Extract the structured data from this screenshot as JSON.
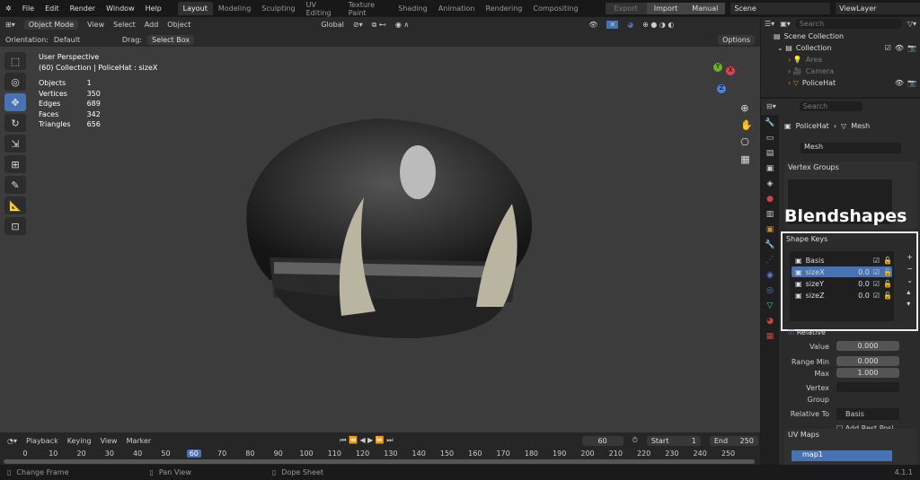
{
  "menu": [
    "File",
    "Edit",
    "Render",
    "Window",
    "Help"
  ],
  "workspaces": [
    "Layout",
    "Modeling",
    "Sculpting",
    "UV Editing",
    "Texture Paint",
    "Shading",
    "Animation",
    "Rendering",
    "Compositing"
  ],
  "top_right": {
    "export": "Export",
    "import": "Import",
    "manual": "Manual",
    "scene": "Scene",
    "view_layer": "ViewLayer"
  },
  "header": {
    "mode": "Object Mode",
    "items": [
      "View",
      "Select",
      "Add",
      "Object"
    ],
    "transform": "Global",
    "options": "Options"
  },
  "tool_settings": {
    "orientation_label": "Orientation:",
    "orientation": "Default",
    "drag_label": "Drag:",
    "drag": "Select Box"
  },
  "viewport": {
    "title": "User Perspective",
    "subtitle": "(60) Collection | PoliceHat : sizeX",
    "stats": [
      {
        "k": "Objects",
        "v": "1"
      },
      {
        "k": "Vertices",
        "v": "350"
      },
      {
        "k": "Edges",
        "v": "689"
      },
      {
        "k": "Faces",
        "v": "342"
      },
      {
        "k": "Triangles",
        "v": "656"
      }
    ],
    "gizmo": {
      "x": "X",
      "y": "Y",
      "z": "Z"
    }
  },
  "outliner": {
    "search": "Search",
    "scene_collection": "Scene Collection",
    "collection": "Collection",
    "items": [
      "Area",
      "Camera",
      "PoliceHat"
    ]
  },
  "properties": {
    "search": "Search",
    "breadcrumb_obj": "PoliceHat",
    "breadcrumb_data": "Mesh",
    "mesh_name": "Mesh",
    "vertex_groups": "Vertex Groups",
    "overlay_label": "Blendshapes",
    "shape_keys": "Shape Keys",
    "keys": [
      {
        "name": "Basis",
        "value": ""
      },
      {
        "name": "sizeX",
        "value": "0.0"
      },
      {
        "name": "sizeY",
        "value": "0.0"
      },
      {
        "name": "sizeZ",
        "value": "0.0"
      }
    ],
    "relative": "Relative",
    "value_label": "Value",
    "value": "0.000",
    "range_min_label": "Range Min",
    "range_min": "0.000",
    "max_label": "Max",
    "max": "1.000",
    "vertex_group_label": "Vertex Group",
    "relative_to_label": "Relative To",
    "relative_to": "Basis",
    "add_rest": "Add Rest Posi...",
    "uv_maps": "UV Maps",
    "uv_map": "map1"
  },
  "timeline": {
    "menus": [
      "Playback",
      "Keying",
      "View",
      "Marker"
    ],
    "current": "60",
    "start_label": "Start",
    "start": "1",
    "end_label": "End",
    "end": "250",
    "ticks": [
      "0",
      "10",
      "20",
      "30",
      "40",
      "50",
      "60",
      "70",
      "80",
      "90",
      "100",
      "110",
      "120",
      "130",
      "140",
      "150",
      "160",
      "170",
      "180",
      "190",
      "200",
      "210",
      "220",
      "230",
      "240",
      "250"
    ]
  },
  "status": {
    "a": "Change Frame",
    "b": "Pan View",
    "c": "Dope Sheet",
    "version": "4.1.1"
  },
  "colors": {
    "accent": "#4772b3",
    "bg": "#3c3c3c"
  }
}
